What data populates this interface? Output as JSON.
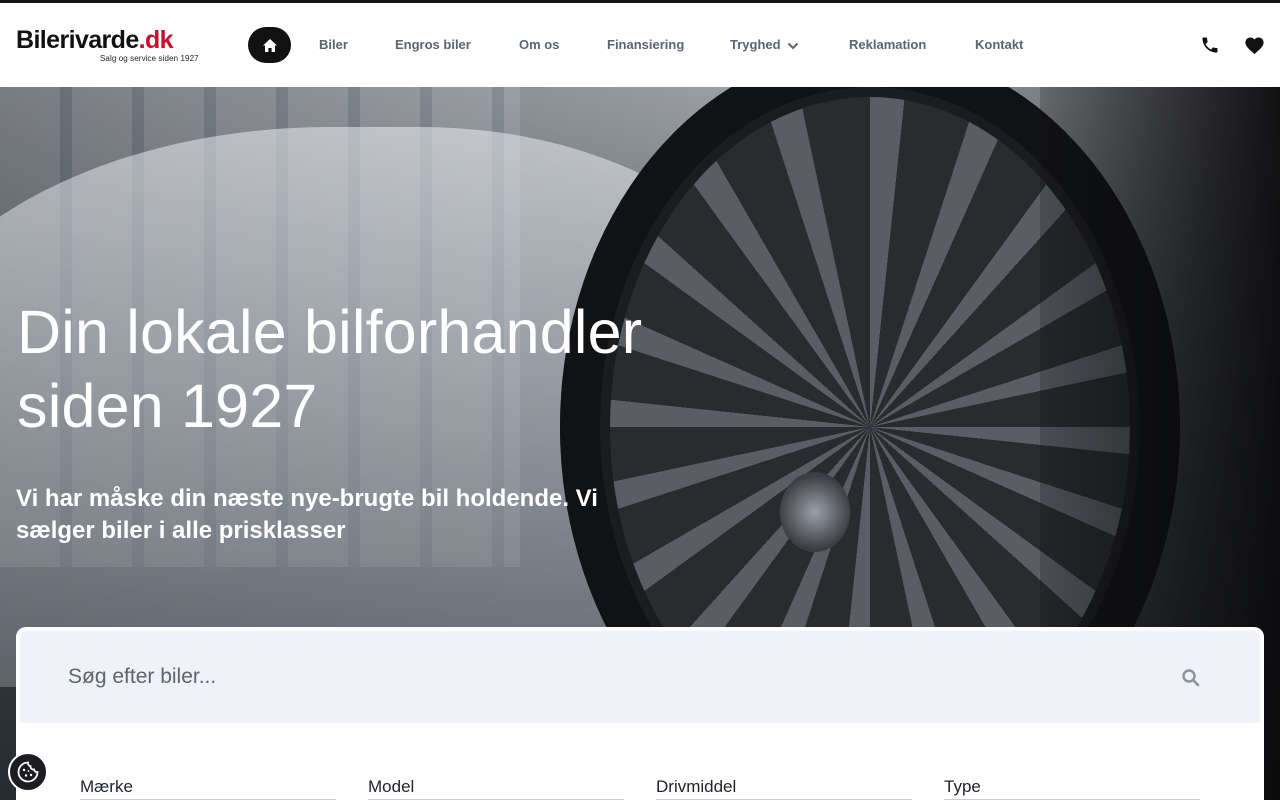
{
  "logo": {
    "name_before_dot": "Bileri",
    "dot": "i",
    "name_after_dot": "varde",
    "tld": ".dk",
    "tagline": "Salg og service siden 1927"
  },
  "nav": {
    "home_icon": "home-icon",
    "items": [
      {
        "label": "Biler"
      },
      {
        "label": "Engros biler"
      },
      {
        "label": "Om os"
      },
      {
        "label": "Finansiering"
      },
      {
        "label": "Tryghed",
        "has_dropdown": true
      },
      {
        "label": "Reklamation"
      },
      {
        "label": "Kontakt"
      }
    ],
    "phone_icon": "phone-icon",
    "favorites_icon": "heart-icon"
  },
  "hero": {
    "title": "Din lokale bilforhandler siden 1927",
    "subtitle": "Vi har måske din næste nye-brugte bil holdende. Vi sælger biler i alle prisklasser"
  },
  "search": {
    "placeholder": "Søg efter biler...",
    "value": "",
    "icon": "search-icon",
    "filters": [
      "Mærke",
      "Model",
      "Drivmiddel",
      "Type"
    ]
  },
  "cookie": {
    "icon": "cookie-icon"
  },
  "colors": {
    "brand_red": "#c8102e",
    "nav_text": "#5b6472",
    "search_bg": "#eff2f7",
    "dark": "#111111"
  }
}
